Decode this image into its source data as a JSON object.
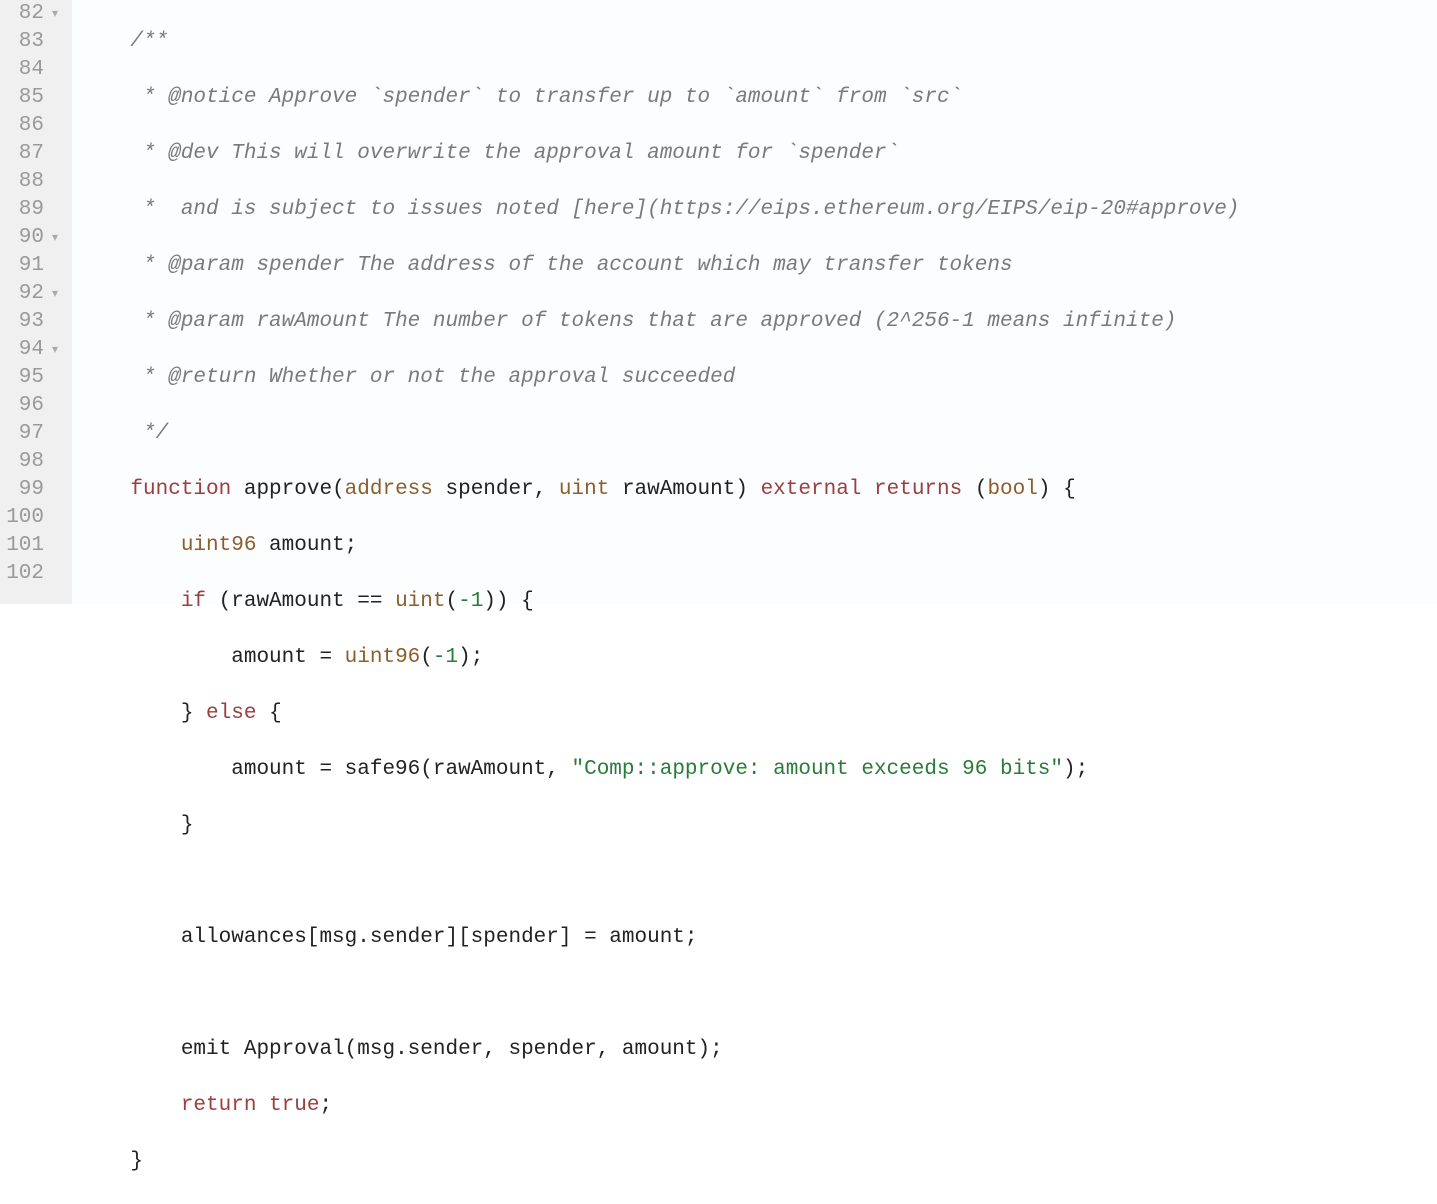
{
  "gutter": {
    "lines": [
      {
        "num": "82",
        "fold": true
      },
      {
        "num": "83",
        "fold": false
      },
      {
        "num": "84",
        "fold": false
      },
      {
        "num": "85",
        "fold": false
      },
      {
        "num": "86",
        "fold": false
      },
      {
        "num": "87",
        "fold": false
      },
      {
        "num": "88",
        "fold": false
      },
      {
        "num": "89",
        "fold": false
      },
      {
        "num": "90",
        "fold": true
      },
      {
        "num": "91",
        "fold": false
      },
      {
        "num": "92",
        "fold": true
      },
      {
        "num": "93",
        "fold": false
      },
      {
        "num": "94",
        "fold": true
      },
      {
        "num": "95",
        "fold": false
      },
      {
        "num": "96",
        "fold": false
      },
      {
        "num": "97",
        "fold": false
      },
      {
        "num": "98",
        "fold": false
      },
      {
        "num": "99",
        "fold": false
      },
      {
        "num": "100",
        "fold": false
      },
      {
        "num": "101",
        "fold": false
      },
      {
        "num": "102",
        "fold": false
      }
    ],
    "fold_glyph": "▾"
  },
  "code": {
    "indent1": "    ",
    "indent2": "        ",
    "indent3": "            ",
    "l82": "/**",
    "l83": " * @notice Approve `spender` to transfer up to `amount` from `src`",
    "l84": " * @dev This will overwrite the approval amount for `spender`",
    "l85": " *  and is subject to issues noted [here](https://eips.ethereum.org/EIPS/eip-20#approve)",
    "l86": " * @param spender The address of the account which may transfer tokens",
    "l87": " * @param rawAmount The number of tokens that are approved (2^256-1 means infinite)",
    "l88": " * @return Whether or not the approval succeeded",
    "l89": " */",
    "l90_function": "function",
    "l90_name": " approve(",
    "l90_addr": "address",
    "l90_spender": " spender, ",
    "l90_uint": "uint",
    "l90_raw": " rawAmount) ",
    "l90_external": "external",
    "l90_returns": " returns",
    "l90_paren": " (",
    "l90_bool": "bool",
    "l90_end": ") {",
    "l91_type": "uint96",
    "l91_rest": " amount;",
    "l92_if": "if",
    "l92_mid": " (rawAmount == ",
    "l92_uint": "uint",
    "l92_paren": "(",
    "l92_neg1": "-1",
    "l92_end": ")) {",
    "l93_left": "amount = ",
    "l93_type": "uint96",
    "l93_paren": "(",
    "l93_neg1": "-1",
    "l93_end": ");",
    "l94_brace": "} ",
    "l94_else": "else",
    "l94_end": " {",
    "l95_left": "amount = safe96(rawAmount, ",
    "l95_str": "\"Comp::approve: amount exceeds 96 bits\"",
    "l95_end": ");",
    "l96": "}",
    "l98": "allowances[msg.sender][spender] = amount;",
    "l100": "emit Approval(msg.sender, spender, amount);",
    "l101_return": "return",
    "l101_sp": " ",
    "l101_true": "true",
    "l101_end": ";",
    "l102": "}"
  }
}
